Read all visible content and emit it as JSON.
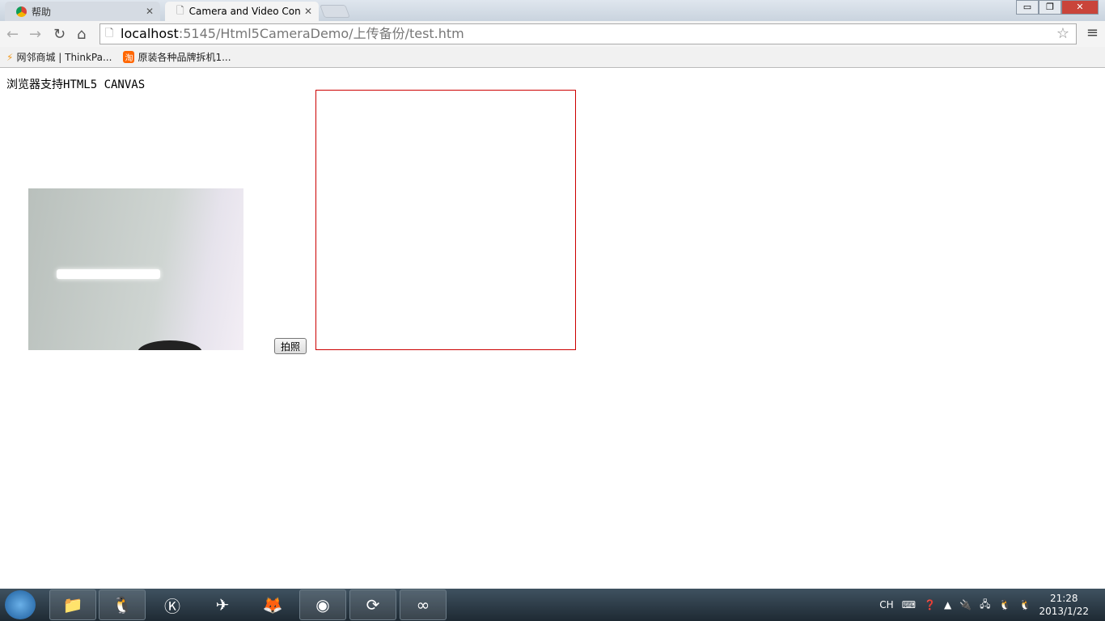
{
  "browser": {
    "tabs": [
      {
        "label": "帮助",
        "icon": "chrome-icon"
      },
      {
        "label": "Camera and Video Con",
        "icon": "page-icon"
      }
    ],
    "url_host": "localhost",
    "url_rest": ":5145/Html5CameraDemo/上传备份/test.htm",
    "bookmarks": [
      {
        "label": "网邻商城 | ThinkPa..."
      },
      {
        "label": "原装各种品牌拆机1..."
      }
    ]
  },
  "page": {
    "support_text": "浏览器支持HTML5 CANVAS",
    "snap_button": "拍照",
    "canvas_border_color": "#cc0000"
  },
  "taskbar": {
    "lang": "CH",
    "time": "21:28",
    "date": "2013/1/22"
  }
}
